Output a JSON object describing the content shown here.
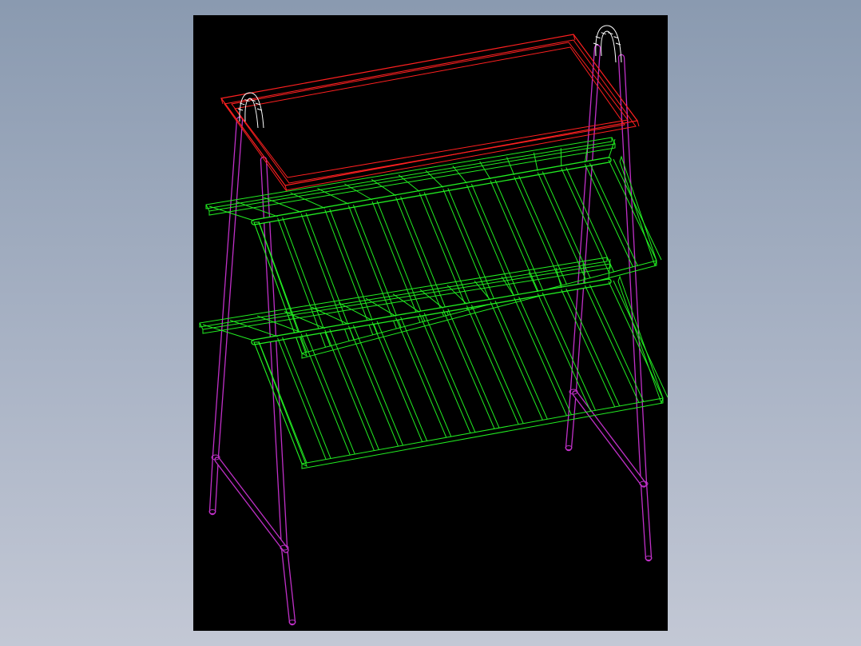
{
  "view": {
    "background": "#000000",
    "surround_gradient": [
      "#8a9ab0",
      "#c3c8d5"
    ]
  },
  "parts": [
    {
      "name": "frame-legs",
      "color": "#c030c8"
    },
    {
      "name": "top-tray",
      "color": "#ff2020"
    },
    {
      "name": "upper-shelf",
      "color": "#22ee22"
    },
    {
      "name": "lower-shelf",
      "color": "#22ee22"
    },
    {
      "name": "top-bends",
      "color": "#ffffff"
    }
  ]
}
